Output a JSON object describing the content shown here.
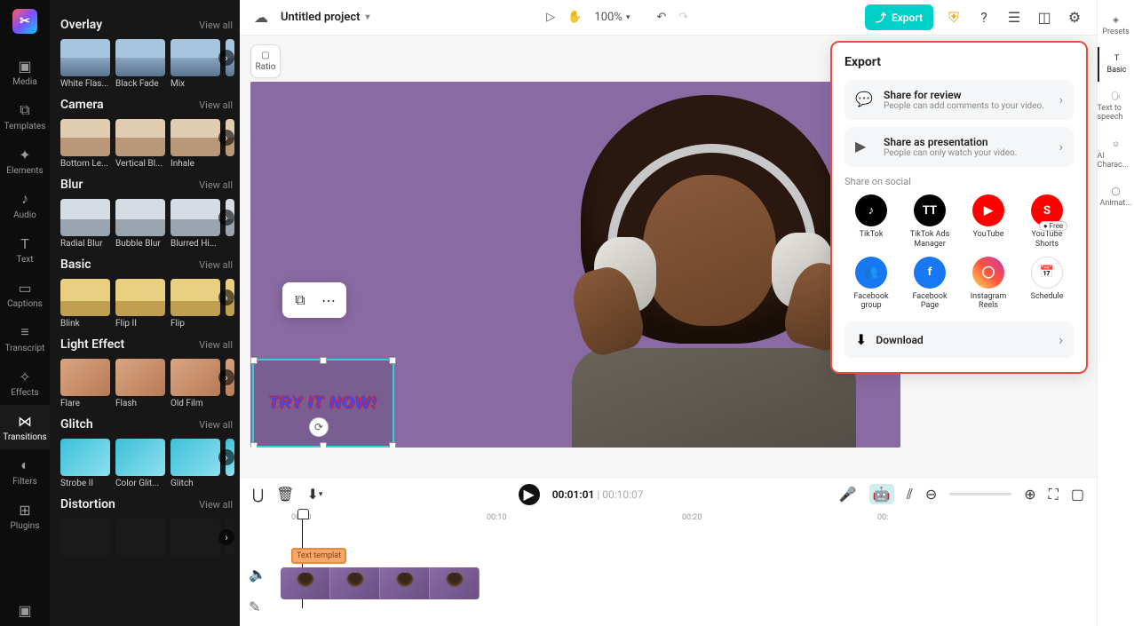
{
  "rail": {
    "items": [
      {
        "label": "Media",
        "icon": "▣"
      },
      {
        "label": "Templates",
        "icon": "⧉"
      },
      {
        "label": "Elements",
        "icon": "✦"
      },
      {
        "label": "Audio",
        "icon": "♪"
      },
      {
        "label": "Text",
        "icon": "T"
      },
      {
        "label": "Captions",
        "icon": "▭"
      },
      {
        "label": "Transcript",
        "icon": "≡"
      },
      {
        "label": "Effects",
        "icon": "✧"
      },
      {
        "label": "Transitions",
        "icon": "⋈"
      },
      {
        "label": "Filters",
        "icon": "◐"
      },
      {
        "label": "Plugins",
        "icon": "⊞"
      }
    ]
  },
  "panel": {
    "view_all": "View all",
    "sections": [
      {
        "title": "Overlay",
        "thumbs": [
          "White Flas...",
          "Black Fade",
          "Mix"
        ],
        "bg": "bg-city"
      },
      {
        "title": "Camera",
        "thumbs": [
          "Bottom Le...",
          "Vertical Bl...",
          "Inhale"
        ],
        "bg": "bg-city2"
      },
      {
        "title": "Blur",
        "thumbs": [
          "Radial Blur",
          "Bubble Blur",
          "Blurred Hi..."
        ],
        "bg": "bg-car"
      },
      {
        "title": "Basic",
        "thumbs": [
          "Blink",
          "Flip II",
          "Flip"
        ],
        "bg": "bg-field"
      },
      {
        "title": "Light Effect",
        "thumbs": [
          "Flare",
          "Flash",
          "Old Film"
        ],
        "bg": "bg-person"
      },
      {
        "title": "Glitch",
        "thumbs": [
          "Strobe II",
          "Color Glit...",
          "Glitch"
        ],
        "bg": "bg-glitch"
      },
      {
        "title": "Distortion",
        "thumbs": [
          "",
          "",
          ""
        ],
        "bg": "bg-dark"
      }
    ]
  },
  "topbar": {
    "project_title": "Untitled project",
    "zoom": "100%",
    "export_label": "Export"
  },
  "canvas": {
    "ratio_label": "Ratio",
    "overlay_text": "TRY IT NOW!"
  },
  "export_popover": {
    "title": "Export",
    "share_review": {
      "title": "Share for review",
      "sub": "People can add comments to your video."
    },
    "share_present": {
      "title": "Share as presentation",
      "sub": "People can only watch your video."
    },
    "social_label": "Share on social",
    "socials": [
      {
        "name": "TikTok",
        "bg": "#000",
        "glyph": "♪"
      },
      {
        "name": "TikTok Ads Manager",
        "bg": "#000",
        "glyph": "TT"
      },
      {
        "name": "YouTube",
        "bg": "#ff0000",
        "glyph": "▶"
      },
      {
        "name": "YouTube Shorts",
        "bg": "#ff0000",
        "glyph": "S"
      },
      {
        "name": "Facebook group",
        "bg": "#1877f2",
        "glyph": "👥"
      },
      {
        "name": "Facebook Page",
        "bg": "#1877f2",
        "glyph": "f"
      },
      {
        "name": "Instagram Reels",
        "bg": "linear-gradient(45deg,#fd5,#ff543e,#c837ab)",
        "glyph": "◯"
      },
      {
        "name": "Schedule",
        "bg": "#fff",
        "glyph": "📅",
        "free": "Free"
      }
    ],
    "download_label": "Download"
  },
  "prop_rail": {
    "items": [
      {
        "label": "Presets",
        "icon": "◈"
      },
      {
        "label": "Basic",
        "icon": "T"
      },
      {
        "label": "Text to speech",
        "icon": "🗣"
      },
      {
        "label": "AI Charac...",
        "icon": "☺"
      },
      {
        "label": "Animat...",
        "icon": "◯"
      }
    ]
  },
  "timeline": {
    "current": "00:01:01",
    "total": "00:10:07",
    "ticks": [
      "00:00",
      "00:10",
      "00:20",
      "00:"
    ],
    "text_clip_label": "Text templat"
  }
}
